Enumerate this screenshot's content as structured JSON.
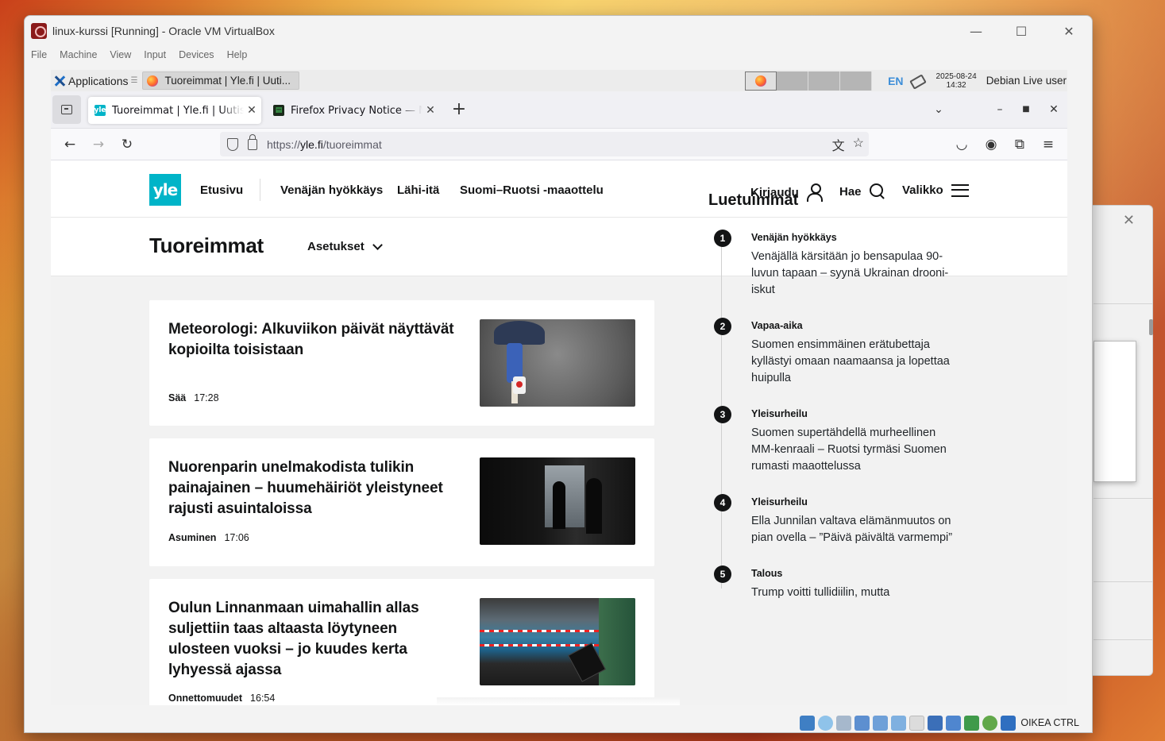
{
  "host": {
    "window_title": "linux-kurssi [Running] - Oracle VM VirtualBox",
    "menu": [
      "File",
      "Machine",
      "View",
      "Input",
      "Devices",
      "Help"
    ],
    "status_key": "OIKEA CTRL"
  },
  "xfce_panel": {
    "applications": "Applications",
    "task_title": "Tuoreimmat | Yle.fi | Uuti...",
    "language": "EN",
    "date": "2025-08-24",
    "time": "14:32",
    "user": "Debian Live user"
  },
  "firefox": {
    "tabs": [
      {
        "title": "Tuoreimmat | Yle.fi | Uutiset",
        "active": true
      },
      {
        "title": "Firefox Privacy Notice — Mozilla",
        "active": false
      }
    ],
    "url_scheme": "https://",
    "url_host": "yle.fi",
    "url_path": "/tuoreimmat"
  },
  "yle": {
    "logo": "yle",
    "nav": [
      "Etusivu",
      "Venäjän hyökkäys",
      "Lähi-itä",
      "Suomi–Ruotsi -maaottelu"
    ],
    "login": "Kirjaudu",
    "search": "Hae",
    "menu": "Valikko",
    "page_title": "Tuoreimmat",
    "settings": "Asetukset",
    "articles": [
      {
        "headline": "Meteorologi: Alkuviikon päivät näyttävät kopioilta toisistaan",
        "category": "Sää",
        "time": "17:28"
      },
      {
        "headline": "Nuorenparin unelmakodista tulikin painajainen – huumehäiriöt yleistyneet rajusti asuintaloissa",
        "category": "Asuminen",
        "time": "17:06"
      },
      {
        "headline": "Oulun Linnanmaan uimahallin allas suljettiin taas altaasta löytyneen ulosteen vuoksi – jo kuudes kerta lyhyessä ajassa",
        "category": "Onnettomuudet",
        "time": "16:54"
      }
    ],
    "most_read_title": "Luetuimmat",
    "most_read": [
      {
        "num": "1",
        "category": "Venäjän hyökkäys",
        "text": "Venäjällä kärsitään jo bensapulaa 90-luvun tapaan – syynä Ukrainan drooni-iskut"
      },
      {
        "num": "2",
        "category": "Vapaa-aika",
        "text": "Suomen ensimmäinen erätubettaja kyllästyi omaan naamaansa ja lopettaa huipulla"
      },
      {
        "num": "3",
        "category": "Yleisurheilu",
        "text": "Suomen supertähdellä murheellinen MM-kenraali – Ruotsi tyrmäsi Suomen rumasti maaottelussa"
      },
      {
        "num": "4",
        "category": "Yleisurheilu",
        "text": "Ella Junnilan valtava elämänmuutos on pian ovella – ”Päivä päivältä varmempi”"
      },
      {
        "num": "5",
        "category": "Talous",
        "text": "Trump voitti tullidiilin, mutta"
      }
    ]
  }
}
